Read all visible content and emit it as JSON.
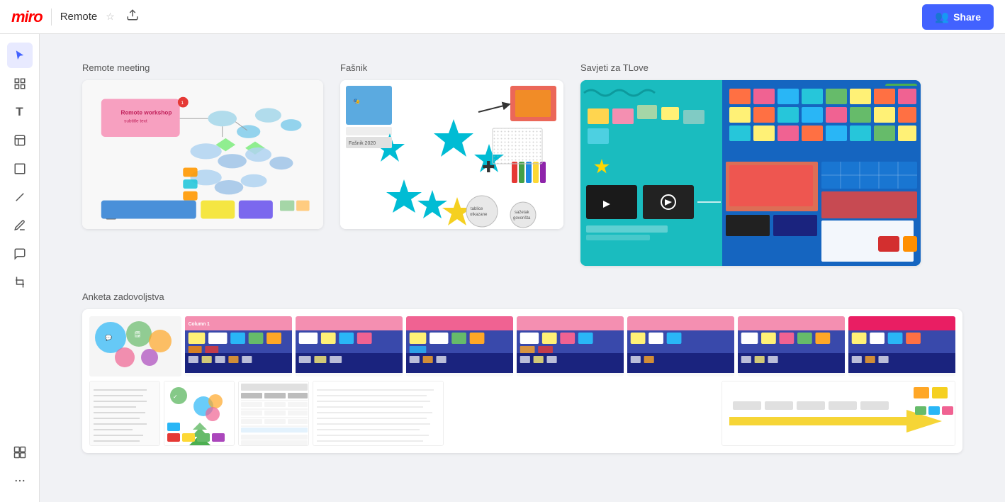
{
  "header": {
    "logo": "miro",
    "title": "Remote",
    "share_label": "Share",
    "share_icon": "👥"
  },
  "sidebar": {
    "tools": [
      {
        "name": "cursor",
        "icon": "↖",
        "active": true
      },
      {
        "name": "frames",
        "icon": "⊞",
        "active": false
      },
      {
        "name": "text",
        "icon": "T",
        "active": false
      },
      {
        "name": "sticky-note",
        "icon": "▱",
        "active": false
      },
      {
        "name": "shape",
        "icon": "□",
        "active": false
      },
      {
        "name": "line",
        "icon": "╱",
        "active": false
      },
      {
        "name": "pen",
        "icon": "✏",
        "active": false
      },
      {
        "name": "comment",
        "icon": "💬",
        "active": false
      },
      {
        "name": "crop",
        "icon": "⊕",
        "active": false
      },
      {
        "name": "apps",
        "icon": "⊞",
        "active": false
      },
      {
        "name": "more",
        "icon": "•••",
        "active": false
      }
    ]
  },
  "sections": [
    {
      "id": "section-remote-meeting",
      "label": "Remote meeting",
      "cards": [
        "remote-meeting"
      ]
    },
    {
      "id": "section-fasnik",
      "label": "Fašnik",
      "cards": [
        "fasnik"
      ]
    },
    {
      "id": "section-savjeti",
      "label": "Savjeti za TLove",
      "cards": [
        "savjeti"
      ]
    },
    {
      "id": "section-anketa",
      "label": "Anketa zadovoljstva",
      "cards": [
        "anketa"
      ]
    }
  ]
}
